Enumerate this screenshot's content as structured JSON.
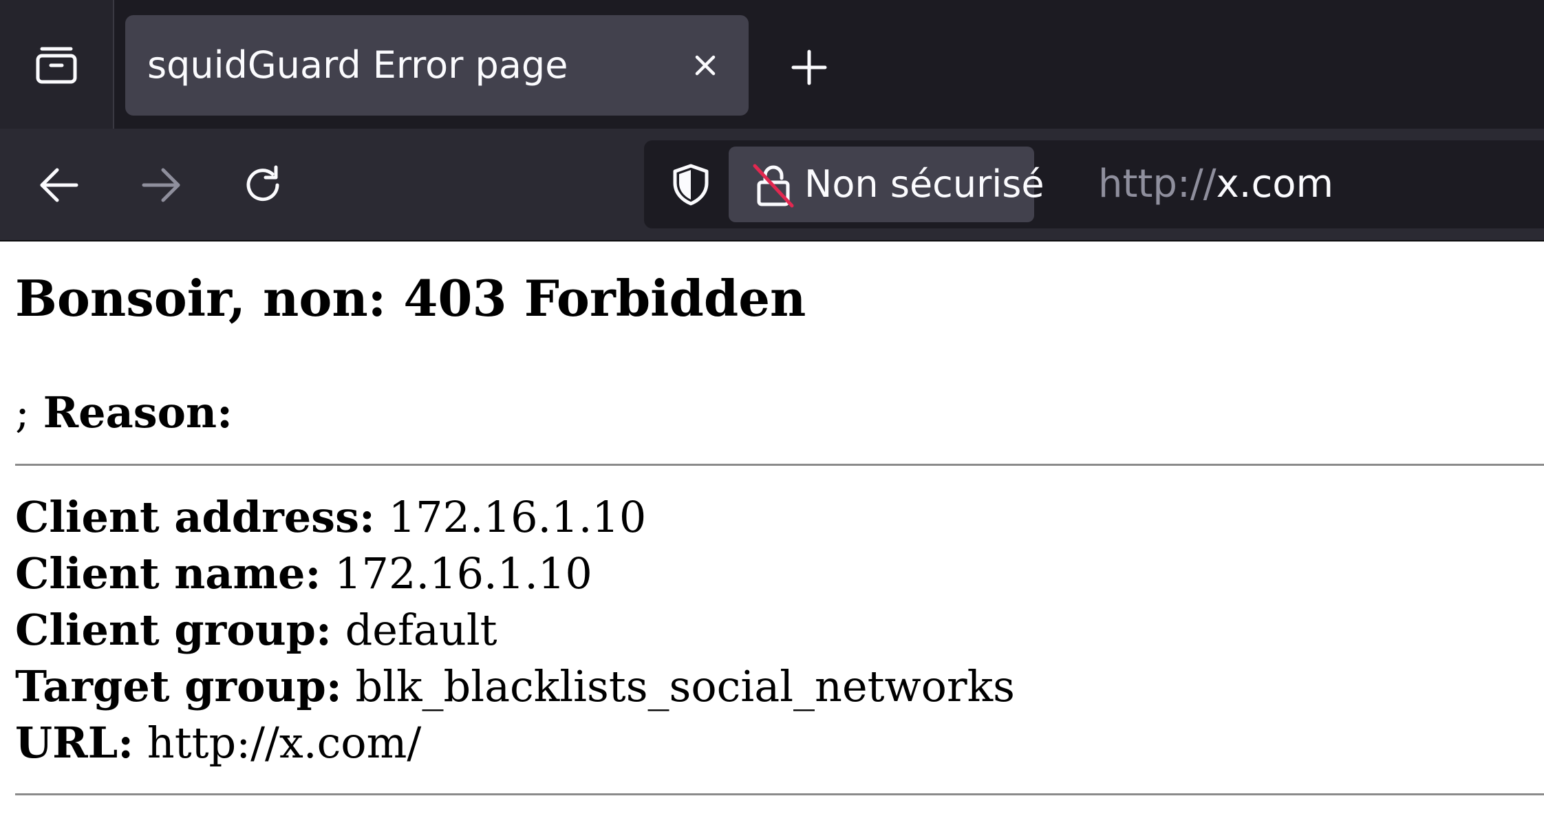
{
  "browser": {
    "tab": {
      "title": "squidGuard Error page",
      "close_glyph": "✕"
    },
    "new_tab_glyph": "+",
    "urlbar": {
      "security_label": "Non sécurisé",
      "url_scheme": "http://",
      "url_host": "x.com"
    },
    "icons": {
      "tab_overview": "tab-overview-icon",
      "back": "back-arrow-icon",
      "forward": "forward-arrow-icon",
      "reload": "reload-icon",
      "shield": "shield-icon",
      "insecure_lock": "insecure-lock-icon"
    },
    "colors": {
      "tabbar_bg": "#1c1b22",
      "active_tab_bg": "#42414d",
      "navbar_bg": "#2b2a33",
      "insecure_slash": "#e22850"
    }
  },
  "page": {
    "heading": "Bonsoir, non: 403 Forbidden",
    "reason_prefix": ";",
    "reason_label": "Reason:",
    "info": [
      {
        "label": "Client address:",
        "value": "172.16.1.10"
      },
      {
        "label": "Client name:",
        "value": "172.16.1.10"
      },
      {
        "label": "Client group:",
        "value": "default"
      },
      {
        "label": "Target group:",
        "value": "blk_blacklists_social_networks"
      },
      {
        "label": "URL:",
        "value": "http://x.com/"
      }
    ]
  }
}
